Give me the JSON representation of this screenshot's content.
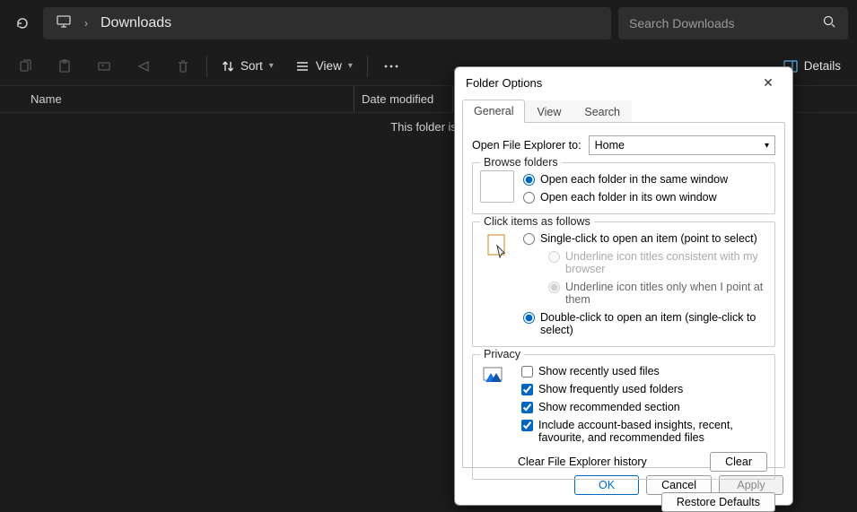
{
  "topbar": {
    "breadcrumb": "Downloads",
    "search_placeholder": "Search Downloads"
  },
  "toolbar": {
    "sort_label": "Sort",
    "view_label": "View",
    "details_label": "Details"
  },
  "headers": {
    "name": "Name",
    "date": "Date modified"
  },
  "content": {
    "empty": "This folder is e"
  },
  "dialog": {
    "title": "Folder Options",
    "tabs": {
      "general": "General",
      "view": "View",
      "search": "Search"
    },
    "open_to_label": "Open File Explorer to:",
    "open_to_value": "Home",
    "browse_folders": {
      "legend": "Browse folders",
      "same_window": "Open each folder in the same window",
      "own_window": "Open each folder in its own window"
    },
    "click_items": {
      "legend": "Click items as follows",
      "single": "Single-click to open an item (point to select)",
      "underline_browser": "Underline icon titles consistent with my browser",
      "underline_point": "Underline icon titles only when I point at them",
      "double": "Double-click to open an item (single-click to select)"
    },
    "privacy": {
      "legend": "Privacy",
      "recent": "Show recently used files",
      "frequent": "Show frequently used folders",
      "recommended": "Show recommended section",
      "account": "Include account-based insights, recent, favourite, and recommended files",
      "clear_label": "Clear File Explorer history",
      "clear_btn": "Clear"
    },
    "restore": "Restore Defaults",
    "ok": "OK",
    "cancel": "Cancel",
    "apply": "Apply"
  }
}
